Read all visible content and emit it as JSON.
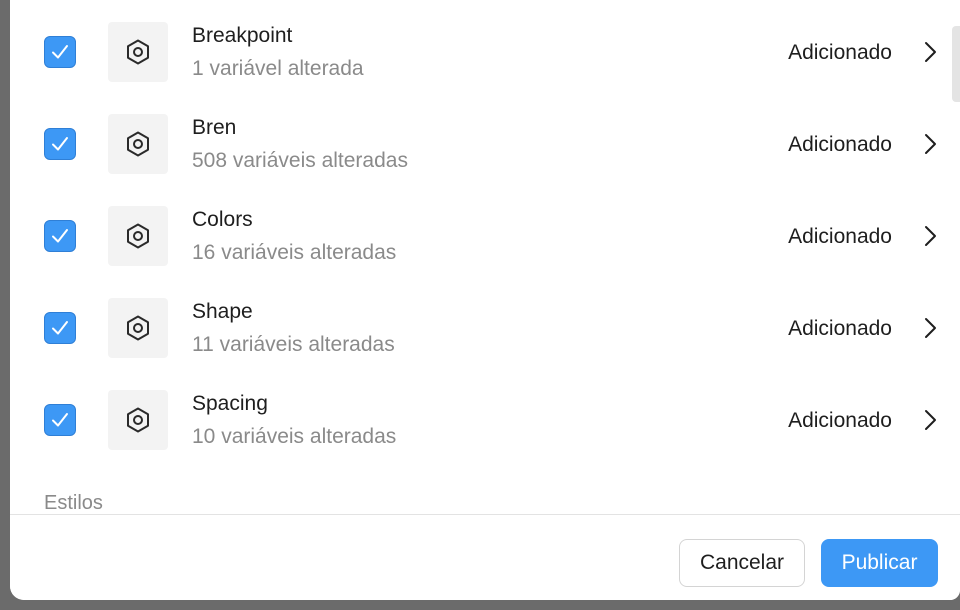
{
  "collections": [
    {
      "name": "Breakpoint",
      "changes": "1 variável alterada",
      "status": "Adicionado",
      "checked": true,
      "icon": "hexagon-icon"
    },
    {
      "name": "Bren",
      "changes": "508 variáveis alteradas",
      "status": "Adicionado",
      "checked": true,
      "icon": "hexagon-icon"
    },
    {
      "name": "Colors",
      "changes": "16 variáveis alteradas",
      "status": "Adicionado",
      "checked": true,
      "icon": "hexagon-icon"
    },
    {
      "name": "Shape",
      "changes": "11 variáveis alteradas",
      "status": "Adicionado",
      "checked": true,
      "icon": "hexagon-icon"
    },
    {
      "name": "Spacing",
      "changes": "10 variáveis alteradas",
      "status": "Adicionado",
      "checked": true,
      "icon": "hexagon-icon"
    }
  ],
  "sections": {
    "styles_label": "Estilos"
  },
  "footer": {
    "cancel_label": "Cancelar",
    "publish_label": "Publicar"
  },
  "colors": {
    "accent": "#3d98f5",
    "muted_text": "#8a8a8a"
  }
}
